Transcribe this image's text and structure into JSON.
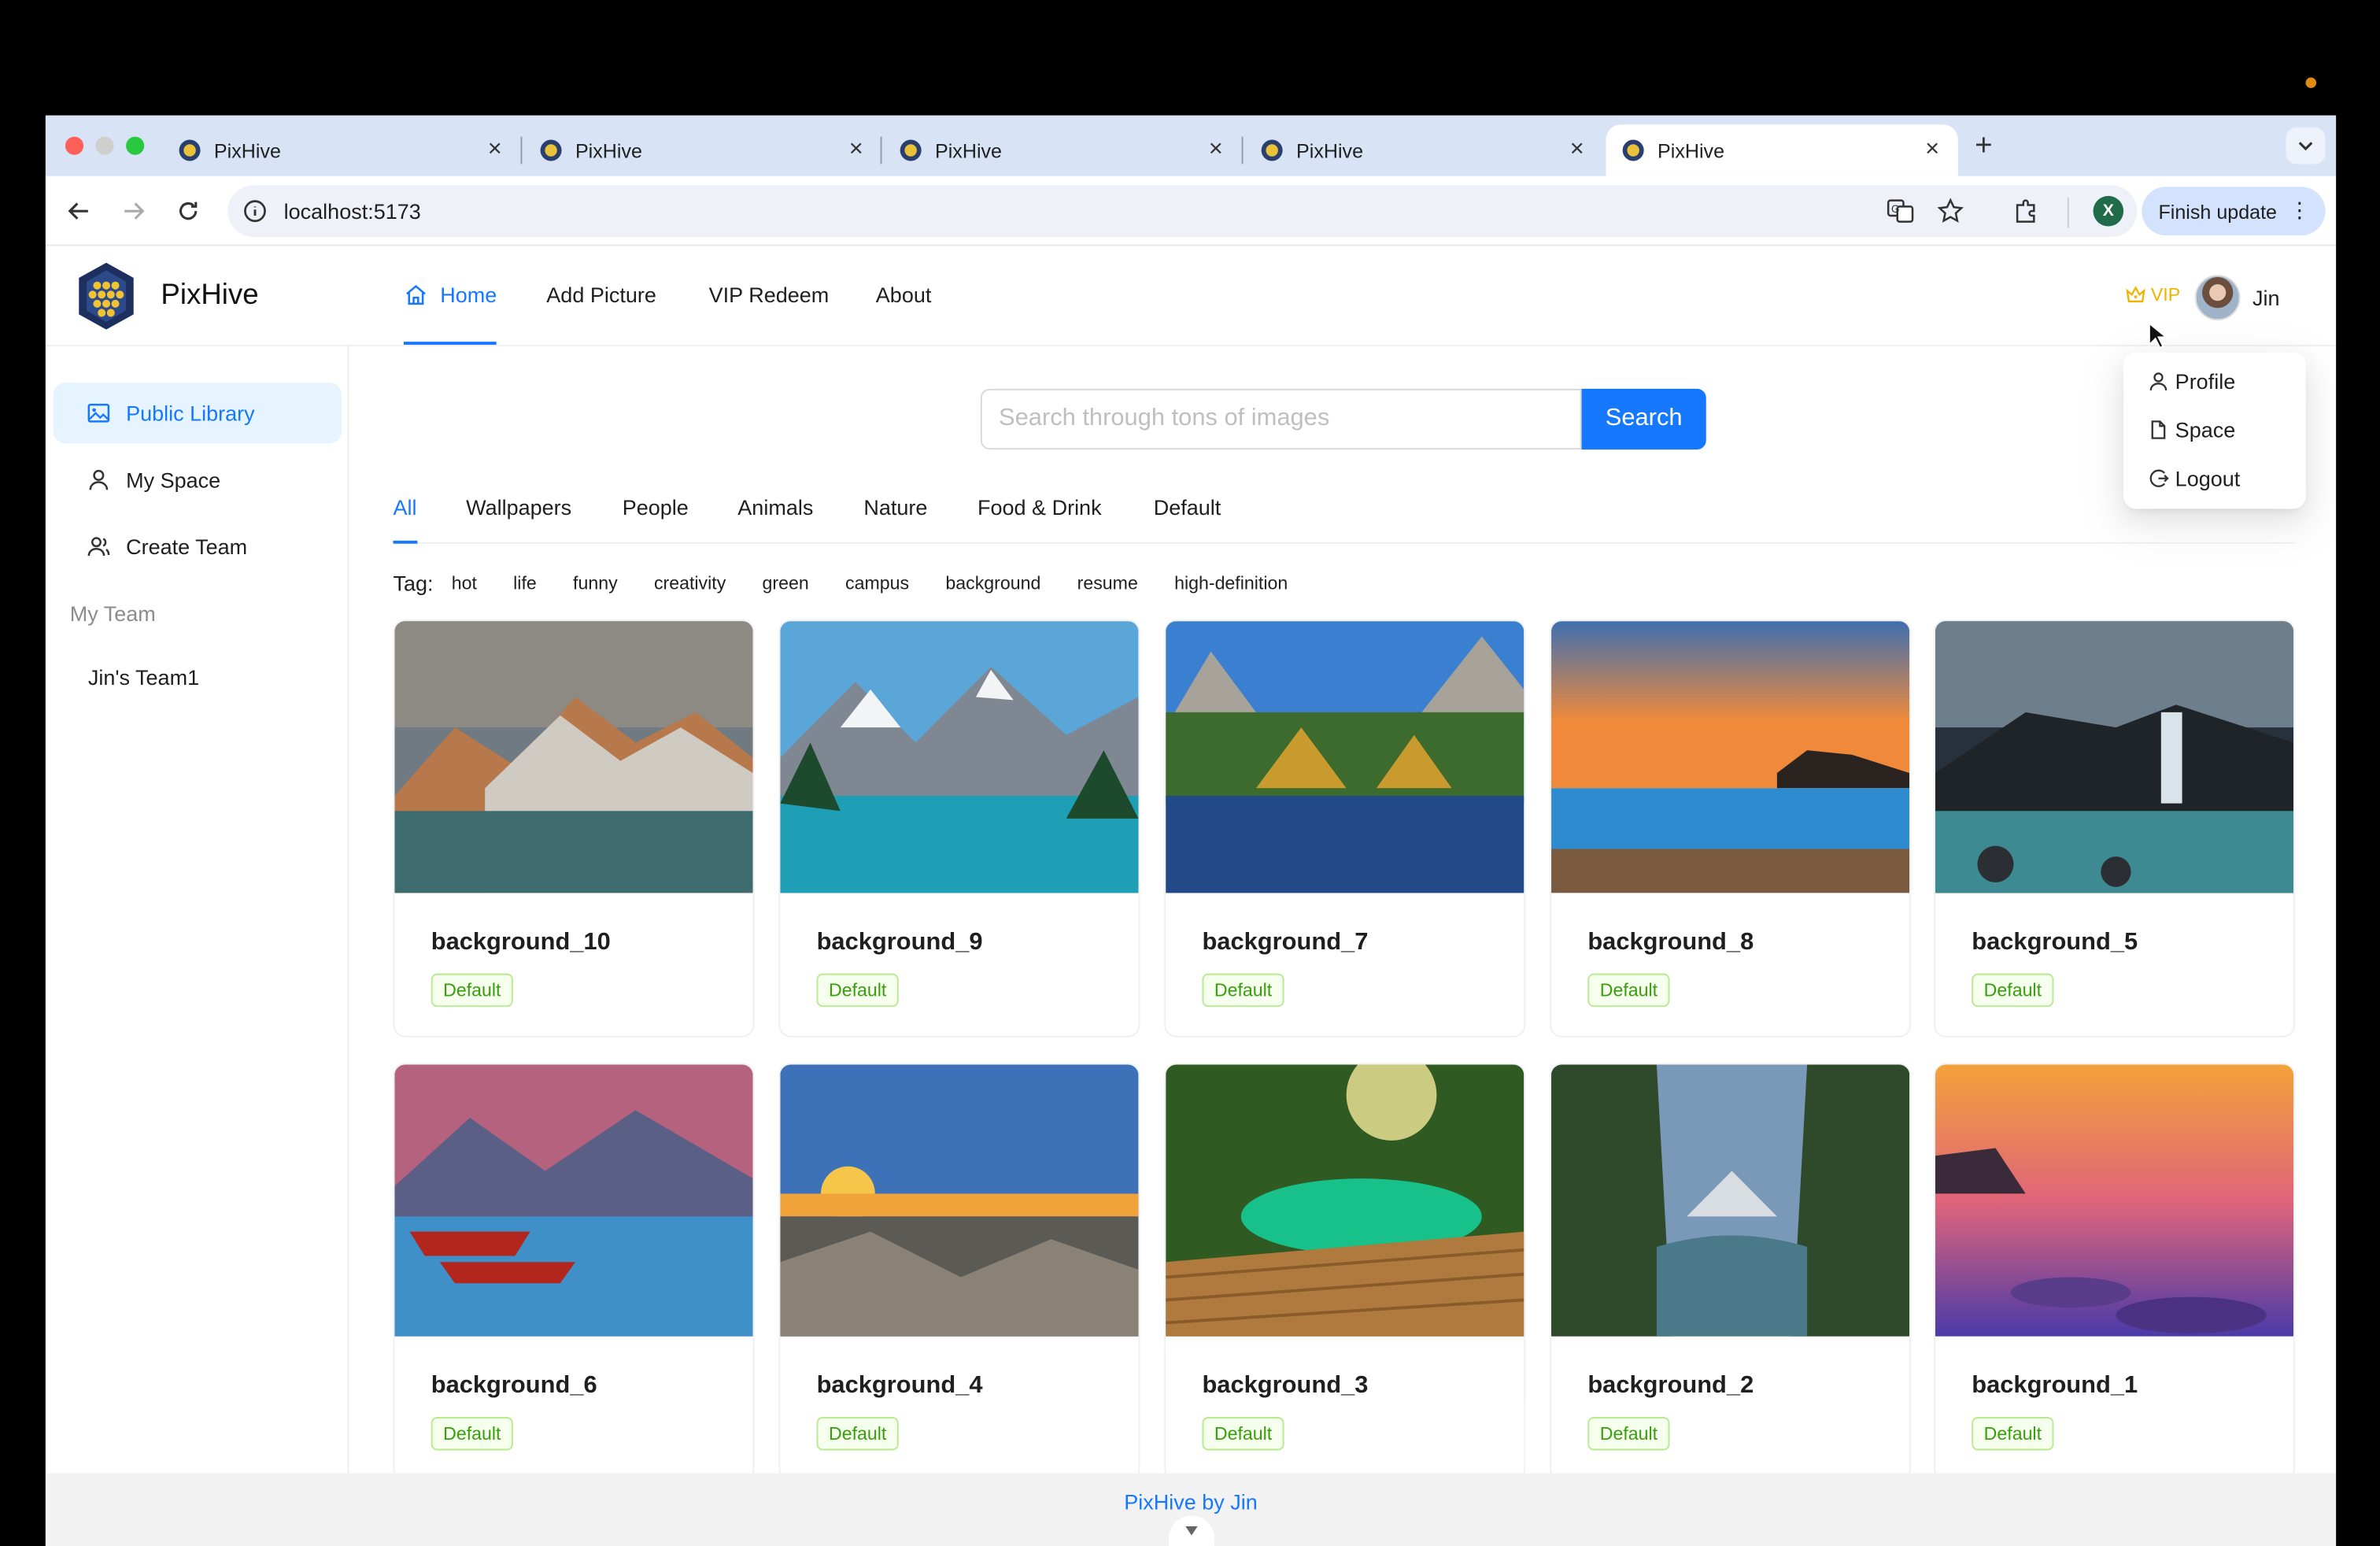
{
  "browser": {
    "tabs": [
      {
        "title": "PixHive",
        "active": false
      },
      {
        "title": "PixHive",
        "active": false
      },
      {
        "title": "PixHive",
        "active": false
      },
      {
        "title": "PixHive",
        "active": false
      },
      {
        "title": "PixHive",
        "active": true
      }
    ],
    "url": "localhost:5173",
    "profile_initial": "X",
    "finish_update_label": "Finish update"
  },
  "header": {
    "brand": "PixHive",
    "menu": [
      {
        "label": "Home",
        "active": true,
        "icon": "home-icon"
      },
      {
        "label": "Add Picture",
        "active": false
      },
      {
        "label": "VIP Redeem",
        "active": false
      },
      {
        "label": "About",
        "active": false
      }
    ],
    "vip_label": "VIP",
    "user_name": "Jin"
  },
  "user_menu": [
    {
      "label": "Profile",
      "icon": "user-icon"
    },
    {
      "label": "Space",
      "icon": "file-icon"
    },
    {
      "label": "Logout",
      "icon": "logout-icon"
    }
  ],
  "sidebar": {
    "items": [
      {
        "label": "Public Library",
        "icon": "picture-icon",
        "active": true
      },
      {
        "label": "My Space",
        "icon": "user-icon",
        "active": false
      },
      {
        "label": "Create Team",
        "icon": "team-icon",
        "active": false
      }
    ],
    "group_label": "My Team",
    "teams": [
      "Jin's Team1"
    ]
  },
  "search": {
    "placeholder": "Search through tons of images",
    "value": "",
    "button_label": "Search"
  },
  "categories": [
    "All",
    "Wallpapers",
    "People",
    "Animals",
    "Nature",
    "Food & Drink",
    "Default"
  ],
  "active_category": "All",
  "tags_label": "Tag:",
  "tags": [
    "hot",
    "life",
    "funny",
    "creativity",
    "green",
    "campus",
    "background",
    "resume",
    "high-definition"
  ],
  "pictures": [
    {
      "name": "background_10",
      "category": "Default"
    },
    {
      "name": "background_9",
      "category": "Default"
    },
    {
      "name": "background_7",
      "category": "Default"
    },
    {
      "name": "background_8",
      "category": "Default"
    },
    {
      "name": "background_5",
      "category": "Default"
    },
    {
      "name": "background_6",
      "category": "Default"
    },
    {
      "name": "background_4",
      "category": "Default"
    },
    {
      "name": "background_3",
      "category": "Default"
    },
    {
      "name": "background_2",
      "category": "Default"
    },
    {
      "name": "background_1",
      "category": "Default"
    }
  ],
  "footer": {
    "text": "PixHive by Jin"
  },
  "colors": {
    "accent": "#1677ff",
    "tag_green": "#389e0d",
    "vip_gold": "#f0b400"
  }
}
